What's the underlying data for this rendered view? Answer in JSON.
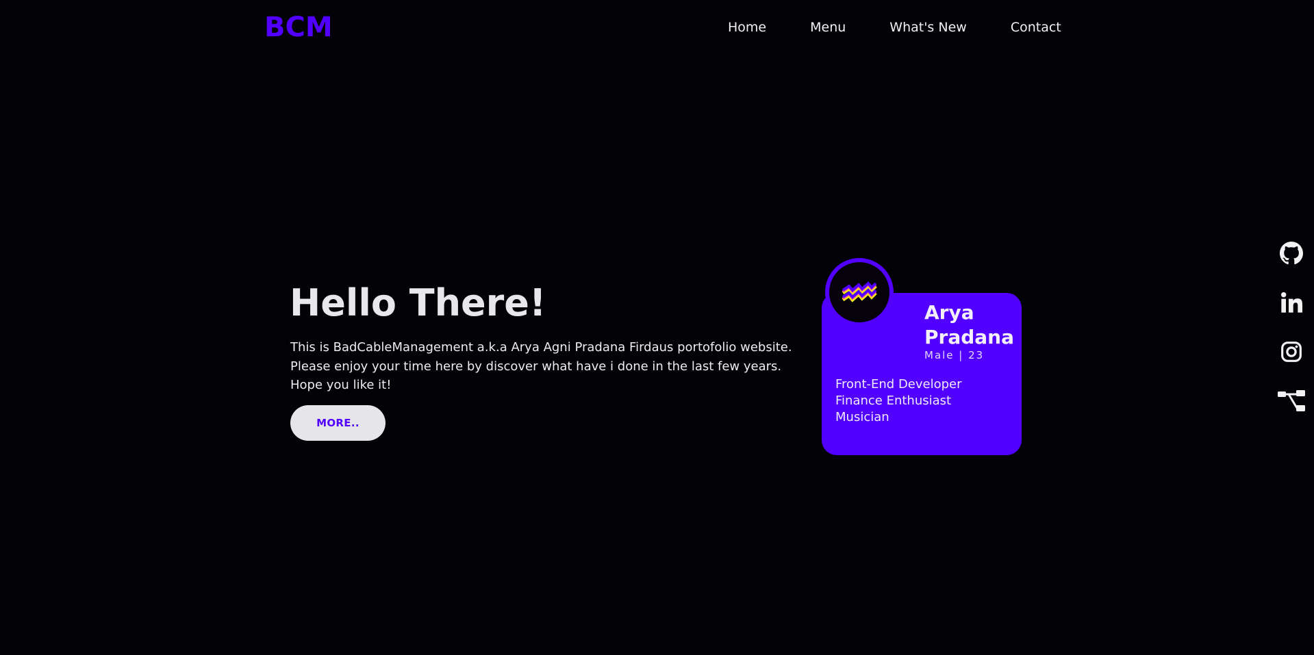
{
  "header": {
    "logo": "BCM",
    "nav": [
      {
        "label": "Home"
      },
      {
        "label": "Menu"
      },
      {
        "label": "What's New"
      },
      {
        "label": "Contact"
      }
    ]
  },
  "hero": {
    "title": "Hello There!",
    "lines": [
      "This is BadCableManagement a.k.a Arya Agni Pradana Firdaus portofolio website.",
      "Please enjoy your time here by discover what have i done in the last few years.",
      "Hope you like it!"
    ],
    "button_label": "MORE.."
  },
  "profile": {
    "name_first": "Arya",
    "name_last": "Pradana",
    "meta": "Male | 23",
    "roles": [
      "Front-End Developer",
      "Finance Enthusiast",
      "Musician"
    ],
    "avatar_icon": "aquarius-icon"
  },
  "social": [
    {
      "icon": "github-icon"
    },
    {
      "icon": "linkedin-icon"
    },
    {
      "icon": "instagram-icon"
    },
    {
      "icon": "sitemap-icon"
    }
  ],
  "colors": {
    "background": "#030207",
    "accent": "#5200ff",
    "text": "#ececf0",
    "button_bg": "#e6e6ea"
  }
}
